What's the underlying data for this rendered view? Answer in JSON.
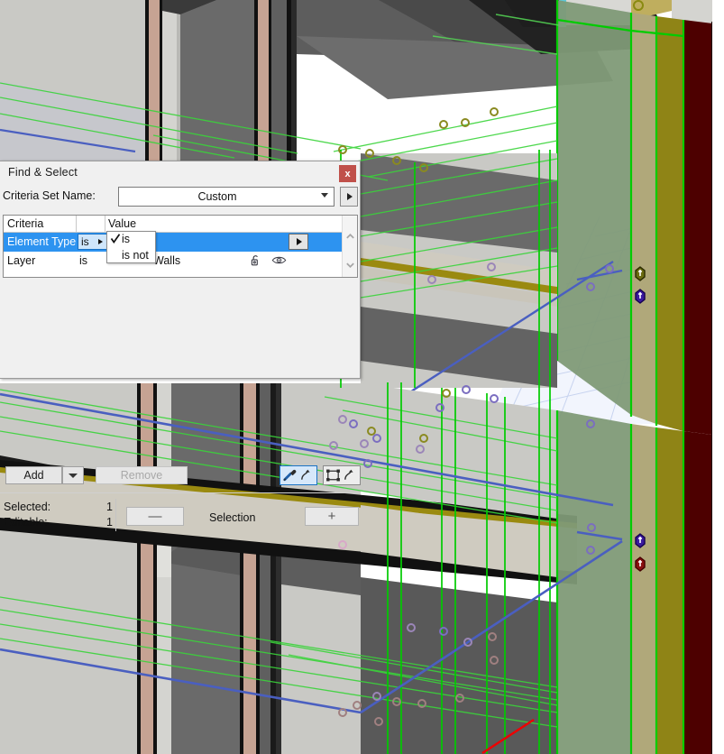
{
  "dialog": {
    "title": "Find & Select",
    "close_label": "x",
    "criteria_set": {
      "label": "Criteria Set Name:",
      "value": "Custom",
      "expand_button_name": "criteria-set-expand"
    },
    "list": {
      "headers": {
        "criteria": "Criteria",
        "value": "Value"
      },
      "rows": [
        {
          "criteria": "Element Type",
          "operator": "is",
          "value": "",
          "selected": true,
          "has_value_dropdown": true,
          "icons": []
        },
        {
          "criteria": "Layer",
          "operator": "is",
          "value": "Walls",
          "selected": false,
          "has_value_dropdown": false,
          "icons": [
            "unlock-icon",
            "eye-icon"
          ]
        }
      ]
    },
    "operator_menu": {
      "visible": true,
      "items": [
        {
          "label": "is",
          "checked": true
        },
        {
          "label": "is not",
          "checked": false
        }
      ]
    },
    "buttons": {
      "add": "Add",
      "add_dropdown_name": "add-dropdown-arrow",
      "remove": "Remove",
      "remove_disabled": true,
      "pickup_settings_name": "pickup-settings-button",
      "inject_settings_name": "inject-settings-button"
    },
    "status": {
      "selected_label": "Selected:",
      "selected_value": "1",
      "editable_label": "Editable:",
      "editable_value": "1",
      "selection_label": "Selection",
      "minus_label": "—",
      "plus_label": "+"
    }
  },
  "colors": {
    "accent_blue": "#2d93f0",
    "close_red": "#c0504a",
    "dialog_bg": "#f0f0f0",
    "highlight_border": "#1a72c4",
    "selection_green": "#00d000",
    "wall_light": "#c8c8c4",
    "wall_dark": "#5a5a5a",
    "mullion": "#c6a393",
    "beam_olive": "#9a8a10",
    "glass_olive": "#8f8416",
    "deep_red": "#4d0000",
    "grid_blue": "#b9c8ea",
    "dim_blue": "#4a5fc0",
    "red_line": "#ee0000"
  },
  "viewport": {
    "name": "archicad-3d-viewport",
    "description": "3D model view with green selection wireframe"
  }
}
